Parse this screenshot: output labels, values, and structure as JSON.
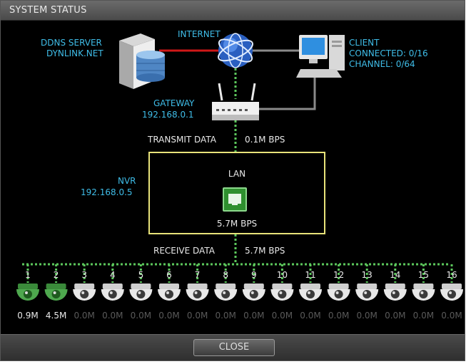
{
  "window": {
    "title": "SYSTEM STATUS"
  },
  "ddns": {
    "line1": "DDNS SERVER",
    "line2": "DYNLINK.NET"
  },
  "internet": {
    "label": "INTERNET"
  },
  "client": {
    "label": "CLIENT",
    "connected": "CONNECTED: 0/16",
    "channel": "CHANNEL: 0/64"
  },
  "gateway": {
    "label": "GATEWAY",
    "ip": "192.168.0.1"
  },
  "transmit": {
    "label": "TRANSMIT DATA",
    "value": "0.1M BPS"
  },
  "nvr": {
    "label": "NVR",
    "ip": "192.168.0.5"
  },
  "lan": {
    "label": "LAN",
    "speed": "5.7M BPS"
  },
  "receive": {
    "label": "RECEIVE DATA",
    "value": "5.7M BPS"
  },
  "cameras": [
    {
      "num": "1",
      "rate": "0.9M",
      "active": true
    },
    {
      "num": "2",
      "rate": "4.5M",
      "active": true
    },
    {
      "num": "3",
      "rate": "0.0M",
      "active": false
    },
    {
      "num": "4",
      "rate": "0.0M",
      "active": false
    },
    {
      "num": "5",
      "rate": "0.0M",
      "active": false
    },
    {
      "num": "6",
      "rate": "0.0M",
      "active": false
    },
    {
      "num": "7",
      "rate": "0.0M",
      "active": false
    },
    {
      "num": "8",
      "rate": "0.0M",
      "active": false
    },
    {
      "num": "9",
      "rate": "0.0M",
      "active": false
    },
    {
      "num": "10",
      "rate": "0.0M",
      "active": false
    },
    {
      "num": "11",
      "rate": "0.0M",
      "active": false
    },
    {
      "num": "12",
      "rate": "0.0M",
      "active": false
    },
    {
      "num": "13",
      "rate": "0.0M",
      "active": false
    },
    {
      "num": "14",
      "rate": "0.0M",
      "active": false
    },
    {
      "num": "15",
      "rate": "0.0M",
      "active": false
    },
    {
      "num": "16",
      "rate": "0.0M",
      "active": false
    }
  ],
  "footer": {
    "close_label": "CLOSE"
  },
  "colors": {
    "accent_cyan": "#3fbde8",
    "active_green": "#4ea84e",
    "nvr_border": "#e8e37a",
    "link_red": "#d01818"
  }
}
